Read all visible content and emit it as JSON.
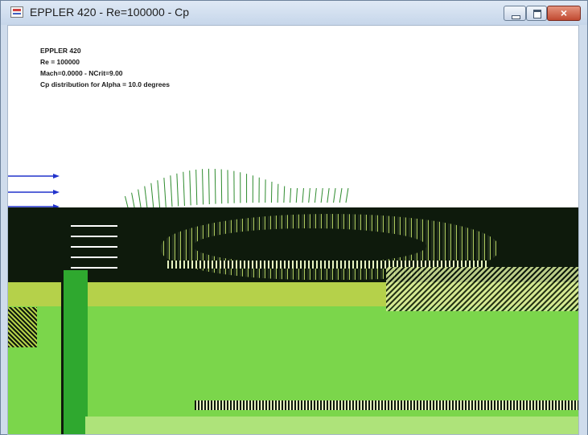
{
  "window": {
    "title": "EPPLER 420 - Re=100000 - Cp",
    "icon": "xflr-doc-icon",
    "controls": {
      "minimize": "minimize-icon",
      "maximize": "maximize-icon",
      "close": "×"
    }
  },
  "info": {
    "airfoil": "EPPLER 420",
    "reynolds": "Re = 100000",
    "mach_ncrit": "Mach=0.0000 - NCrit=9.00",
    "distribution": "Cp distribution for  Alpha = 10.0 degrees"
  },
  "colors": {
    "arrow": "#2233cc",
    "cp_vector": "#2e8b2e",
    "dark_band": "#0e1a0c",
    "lime_fill": "#7bd64b",
    "olive_strip": "#b5d14a",
    "light_green": "#aee37a"
  }
}
